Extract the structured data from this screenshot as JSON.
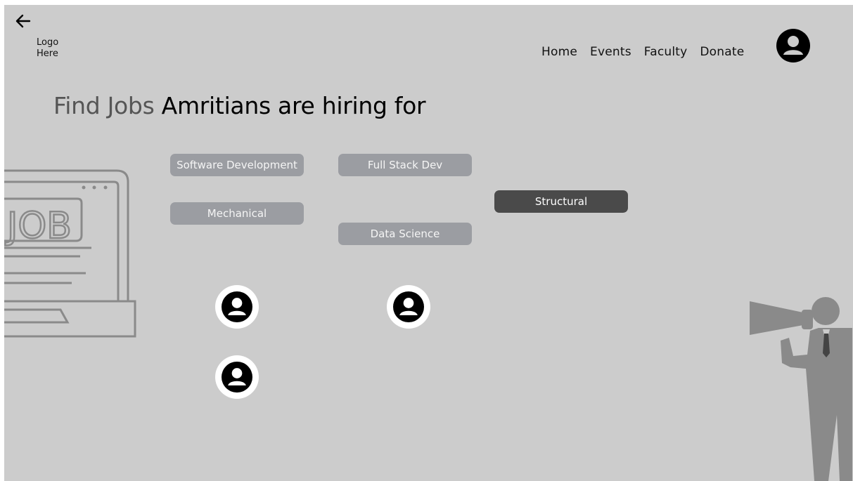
{
  "header": {
    "logo_text_line1": "Logo",
    "logo_text_line2": "Here",
    "nav": [
      "Home",
      "Events",
      "Faculty",
      "Donate"
    ]
  },
  "main": {
    "headline_muted": "Find Jobs",
    "headline_strong": "Amritians are hiring for",
    "categories": [
      {
        "label": "Software Development",
        "selected": false
      },
      {
        "label": "Full Stack Dev",
        "selected": false
      },
      {
        "label": "Mechanical",
        "selected": false
      },
      {
        "label": "Data Science",
        "selected": false
      },
      {
        "label": "Structural",
        "selected": true
      }
    ]
  },
  "illustration": {
    "job_text": "JOB"
  },
  "colors": {
    "background": "#cccccc",
    "chip": "#9b9da2",
    "chip_selected": "#4a4a4a",
    "illustration": "#8a8a8a"
  },
  "icons": [
    "back-arrow-icon",
    "user-icon",
    "job-laptop-illustration",
    "megaphone-man-illustration"
  ]
}
